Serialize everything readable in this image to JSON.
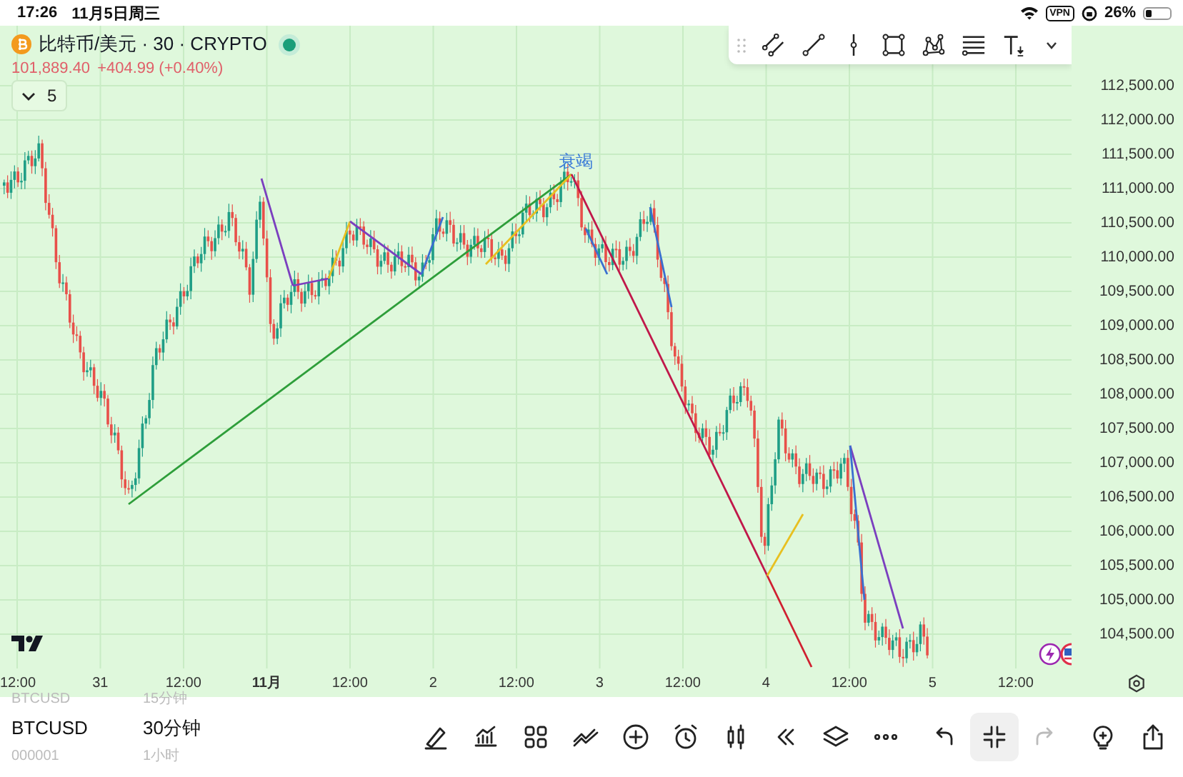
{
  "status_bar": {
    "time": "17:26",
    "date": "11月5日周三",
    "vpn": "VPN",
    "battery": "26%"
  },
  "legend": {
    "symbol": "比特币/美元 · 30 · CRYPTO",
    "market_open": true,
    "price": "101,889.40",
    "change": "+404.99 (+0.40%)",
    "indicator_count": "5"
  },
  "drawing_toolbar": [
    {
      "kind": "parallel"
    },
    {
      "kind": "line"
    },
    {
      "kind": "vertical"
    },
    {
      "kind": "rectangle"
    },
    {
      "kind": "pattern"
    },
    {
      "kind": "levels"
    },
    {
      "kind": "text"
    }
  ],
  "chart": {
    "annotation": "衰竭",
    "price_axis": [
      "112,500.00",
      "112,000.00",
      "111,500.00",
      "111,000.00",
      "110,500.00",
      "110,000.00",
      "109,500.00",
      "109,000.00",
      "108,500.00",
      "108,000.00",
      "107,500.00",
      "107,000.00",
      "106,500.00",
      "106,000.00",
      "105,500.00",
      "105,000.00",
      "104,500.00"
    ],
    "time_axis": [
      {
        "label": "12:00",
        "emphasis": false
      },
      {
        "label": "31",
        "emphasis": false
      },
      {
        "label": "12:00",
        "emphasis": false
      },
      {
        "label": "11月",
        "emphasis": true
      },
      {
        "label": "12:00",
        "emphasis": false
      },
      {
        "label": "2",
        "emphasis": false
      },
      {
        "label": "12:00",
        "emphasis": false
      },
      {
        "label": "3",
        "emphasis": false
      },
      {
        "label": "12:00",
        "emphasis": false
      },
      {
        "label": "4",
        "emphasis": false
      },
      {
        "label": "12:00",
        "emphasis": false
      },
      {
        "label": "5",
        "emphasis": false
      },
      {
        "label": "12:00",
        "emphasis": false
      }
    ]
  },
  "symbol_picker": [
    {
      "label": "BTCUSD",
      "selected": false
    },
    {
      "label": "BTCUSD",
      "selected": true
    },
    {
      "label": "000001",
      "selected": false
    }
  ],
  "interval_picker": [
    {
      "label": "15分钟",
      "selected": false
    },
    {
      "label": "30分钟",
      "selected": true
    },
    {
      "label": "1小时",
      "selected": false
    }
  ],
  "toolbar": [
    {
      "kind": "pen",
      "selected": false,
      "disabled": false
    },
    {
      "kind": "indicators",
      "selected": false,
      "disabled": false
    },
    {
      "kind": "grid",
      "selected": false,
      "disabled": false
    },
    {
      "kind": "strategy",
      "selected": false,
      "disabled": false
    },
    {
      "kind": "add",
      "selected": false,
      "disabled": false
    },
    {
      "kind": "alarm",
      "selected": false,
      "disabled": false
    },
    {
      "kind": "candles",
      "selected": false,
      "disabled": false
    },
    {
      "kind": "rewind",
      "selected": false,
      "disabled": false
    },
    {
      "kind": "layers",
      "selected": false,
      "disabled": false
    },
    {
      "kind": "more",
      "selected": false,
      "disabled": false
    },
    {
      "kind": "undo",
      "selected": false,
      "disabled": false
    },
    {
      "kind": "collapse",
      "selected": true,
      "disabled": false
    },
    {
      "kind": "redo",
      "selected": false,
      "disabled": true
    },
    {
      "kind": "idea",
      "selected": false,
      "disabled": false
    },
    {
      "kind": "share",
      "selected": false,
      "disabled": false
    }
  ]
}
